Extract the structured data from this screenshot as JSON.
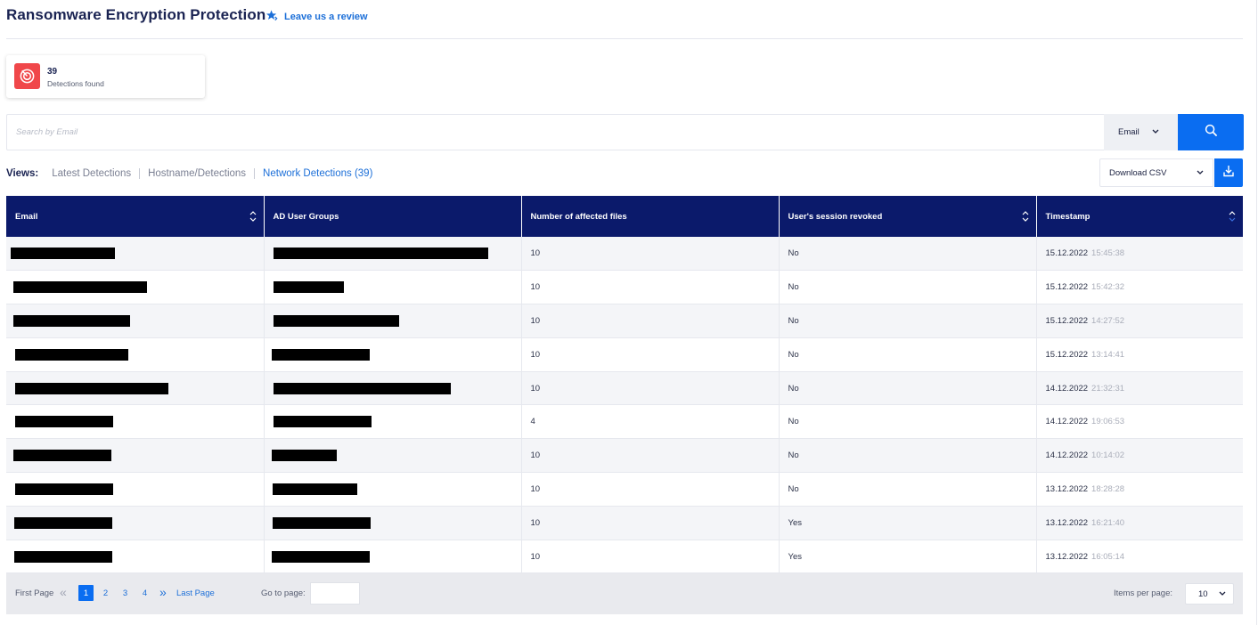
{
  "header": {
    "title": "Ransomware Encryption Protection",
    "review_label": "Leave us a review"
  },
  "stat": {
    "count": "39",
    "label": "Detections found"
  },
  "search": {
    "placeholder": "Search by Email",
    "value": "",
    "field": "Email"
  },
  "views": {
    "label": "Views:",
    "tabs": [
      {
        "label": "Latest Detections",
        "active": false
      },
      {
        "label": "Hostname/Detections",
        "active": false
      },
      {
        "label": "Network Detections (39)",
        "active": true
      }
    ]
  },
  "export": {
    "label": "Download CSV"
  },
  "table": {
    "columns": [
      "Email",
      "AD User Groups",
      "Number of affected files",
      "User's session revoked",
      "Timestamp"
    ],
    "rows": [
      {
        "files": "10",
        "revoked": "No",
        "date": "15.12.2022",
        "time": "15:45:38"
      },
      {
        "files": "10",
        "revoked": "No",
        "date": "15.12.2022",
        "time": "15:42:32"
      },
      {
        "files": "10",
        "revoked": "No",
        "date": "15.12.2022",
        "time": "14:27:52"
      },
      {
        "files": "10",
        "revoked": "No",
        "date": "15.12.2022",
        "time": "13:14:41"
      },
      {
        "files": "10",
        "revoked": "No",
        "date": "14.12.2022",
        "time": "21:32:31"
      },
      {
        "files": "4",
        "revoked": "No",
        "date": "14.12.2022",
        "time": "19:06:53"
      },
      {
        "files": "10",
        "revoked": "No",
        "date": "14.12.2022",
        "time": "10:14:02"
      },
      {
        "files": "10",
        "revoked": "No",
        "date": "13.12.2022",
        "time": "18:28:28"
      },
      {
        "files": "10",
        "revoked": "Yes",
        "date": "13.12.2022",
        "time": "16:21:40"
      },
      {
        "files": "10",
        "revoked": "Yes",
        "date": "13.12.2022",
        "time": "16:05:14"
      }
    ]
  },
  "pagination": {
    "first_label": "First Page",
    "last_label": "Last Page",
    "pages": [
      "1",
      "2",
      "3",
      "4"
    ],
    "current": "1",
    "goto_label": "Go to page:",
    "goto_value": "",
    "items_label": "Items per page:",
    "items_value": "10"
  },
  "colors": {
    "header_bg": "#0b1a6b",
    "accent": "#0a6df1",
    "alert": "#f0474a",
    "link": "#1c6fd8"
  }
}
